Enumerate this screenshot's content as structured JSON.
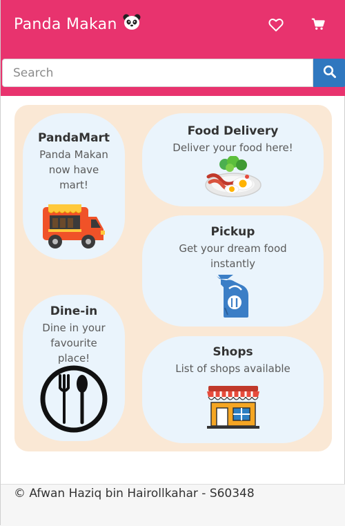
{
  "header": {
    "title": "Panda Makan",
    "brand_emoji_icon": "panda-face-icon",
    "favorites_icon": "heart-icon",
    "cart_icon": "cart-icon",
    "color": "#e8336e"
  },
  "search": {
    "placeholder": "Search",
    "value": "",
    "button_icon": "search-icon",
    "button_color": "#2f77bf"
  },
  "services": [
    {
      "title": "PandaMart",
      "description": "Panda Makan now have mart!",
      "icon": "food-truck-icon"
    },
    {
      "title": "Food Delivery",
      "description": "Deliver your food here!",
      "icon": "breakfast-plate-icon"
    },
    {
      "title": "Pickup",
      "description": "Get your dream food instantly",
      "icon": "takeaway-bag-icon"
    },
    {
      "title": "Dine-in",
      "description": "Dine in your favourite place!",
      "icon": "fork-spoon-plate-icon"
    },
    {
      "title": "Shops",
      "description": "List of shops available",
      "icon": "storefront-icon"
    }
  ],
  "footer": {
    "text": "© Afwan Haziq bin Hairollkahar - S60348"
  },
  "colors": {
    "panel": "#fae8d5",
    "card": "#eaf4fc"
  }
}
